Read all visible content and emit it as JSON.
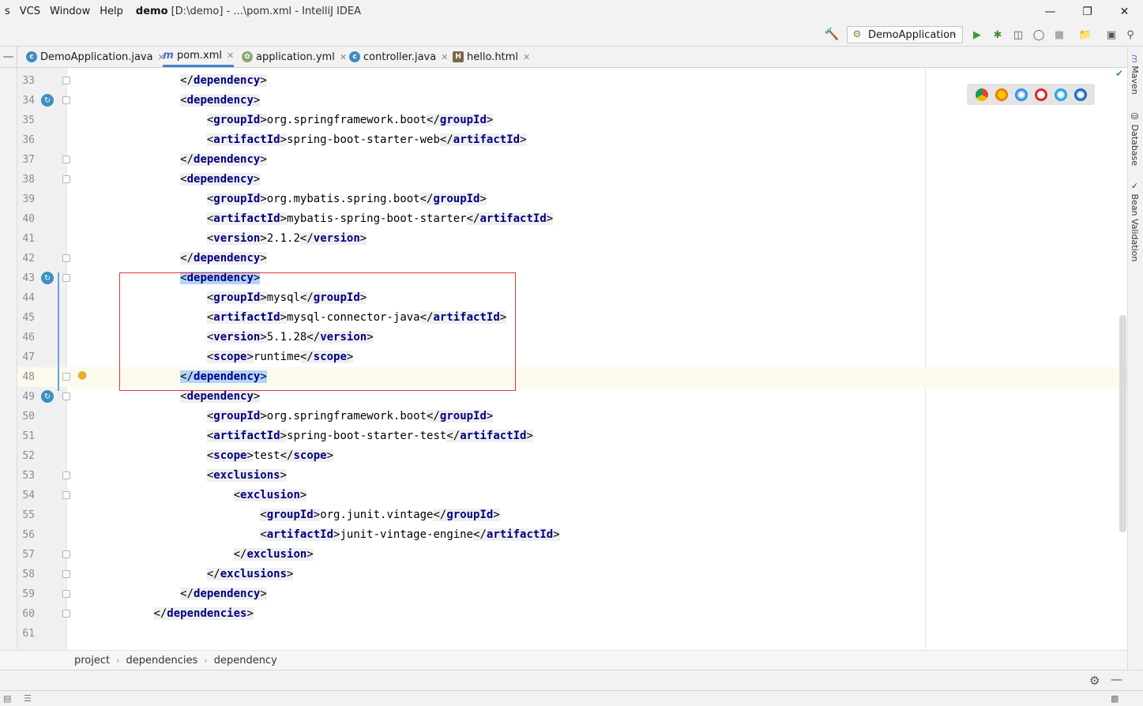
{
  "menu": {
    "items": [
      "s",
      "VCS",
      "Window",
      "Help"
    ]
  },
  "window": {
    "project": "demo",
    "title_rest": "[D:\\demo] - ...\\pom.xml - IntelliJ IDEA"
  },
  "toolbar": {
    "run_config": "DemoApplication"
  },
  "tabs": [
    {
      "label": "DemoApplication.java",
      "icon": "class-c-icon",
      "active": false
    },
    {
      "label": "pom.xml",
      "icon": "maven-m-icon",
      "active": true
    },
    {
      "label": "application.yml",
      "icon": "yaml-leaf-icon",
      "active": false
    },
    {
      "label": "controller.java",
      "icon": "class-c-icon",
      "active": false
    },
    {
      "label": "hello.html",
      "icon": "html-icon",
      "active": false
    }
  ],
  "editor": {
    "lines": [
      {
        "n": "33",
        "t": "            </dependency>"
      },
      {
        "n": "34",
        "t": "            <dependency>"
      },
      {
        "n": "35",
        "t": "                <groupId>org.springframework.boot</groupId>"
      },
      {
        "n": "36",
        "t": "                <artifactId>spring-boot-starter-web</artifactId>"
      },
      {
        "n": "37",
        "t": "            </dependency>"
      },
      {
        "n": "38",
        "t": "            <dependency>"
      },
      {
        "n": "39",
        "t": "                <groupId>org.mybatis.spring.boot</groupId>"
      },
      {
        "n": "40",
        "t": "                <artifactId>mybatis-spring-boot-starter</artifactId>"
      },
      {
        "n": "41",
        "t": "                <version>2.1.2</version>"
      },
      {
        "n": "42",
        "t": "            </dependency>"
      },
      {
        "n": "43",
        "t": "            <dependency>"
      },
      {
        "n": "44",
        "t": "                <groupId>mysql</groupId>"
      },
      {
        "n": "45",
        "t": "                <artifactId>mysql-connector-java</artifactId>"
      },
      {
        "n": "46",
        "t": "                <version>5.1.28</version>"
      },
      {
        "n": "47",
        "t": "                <scope>runtime</scope>"
      },
      {
        "n": "48",
        "t": "            </dependency>"
      },
      {
        "n": "49",
        "t": "            <dependency>"
      },
      {
        "n": "50",
        "t": "                <groupId>org.springframework.boot</groupId>"
      },
      {
        "n": "51",
        "t": "                <artifactId>spring-boot-starter-test</artifactId>"
      },
      {
        "n": "52",
        "t": "                <scope>test</scope>"
      },
      {
        "n": "53",
        "t": "                <exclusions>"
      },
      {
        "n": "54",
        "t": "                    <exclusion>"
      },
      {
        "n": "55",
        "t": "                        <groupId>org.junit.vintage</groupId>"
      },
      {
        "n": "56",
        "t": "                        <artifactId>junit-vintage-engine</artifactId>"
      },
      {
        "n": "57",
        "t": "                    </exclusion>"
      },
      {
        "n": "58",
        "t": "                </exclusions>"
      },
      {
        "n": "59",
        "t": "            </dependency>"
      },
      {
        "n": "60",
        "t": "        </dependencies>"
      },
      {
        "n": "61",
        "t": ""
      }
    ]
  },
  "breadcrumb": [
    "project",
    "dependencies",
    "dependency"
  ],
  "right_panels": [
    "Maven",
    "Database",
    "Bean Validation"
  ],
  "colors": {
    "tag": "#000080",
    "selection": "#b3d4fc",
    "current_line": "#fcfaed",
    "red_box": "#e2363a",
    "active_tab": "#4083c9"
  }
}
